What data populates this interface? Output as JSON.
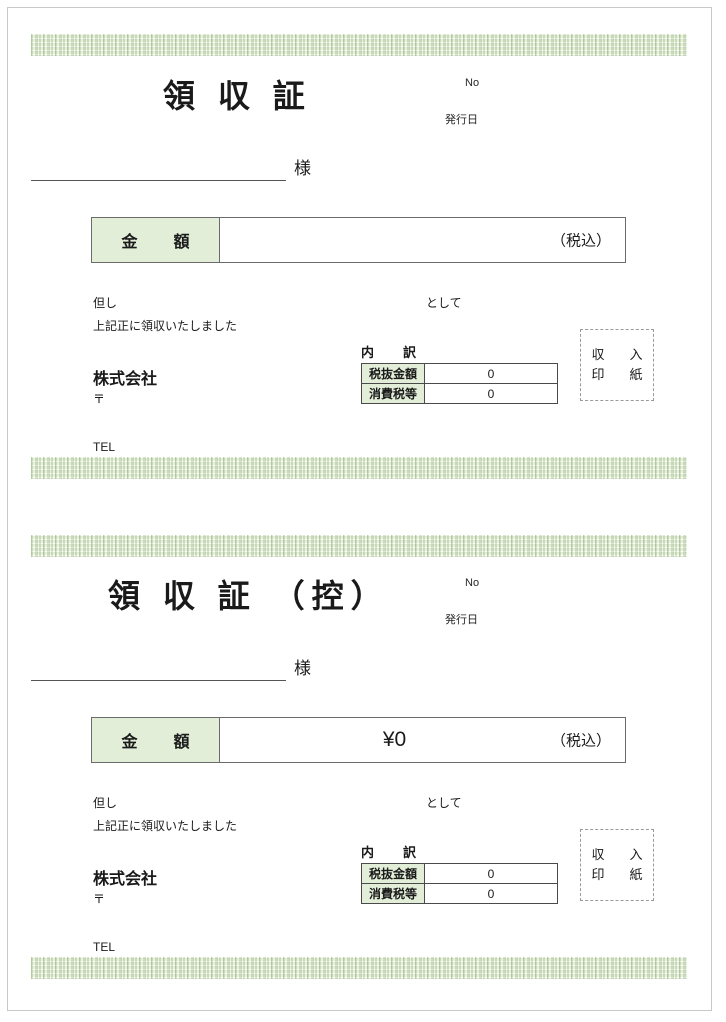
{
  "document": {
    "type": "japanese-receipt-template",
    "page_count": 1
  },
  "receipts": [
    {
      "id": "receipt-original",
      "title": "領 収 証",
      "no_label": "No",
      "issue_date_label": "発行日",
      "addressee_suffix": "様",
      "amount": {
        "label": "金　額",
        "value": "",
        "tax_note": "（税込）"
      },
      "notes": {
        "tadashi": "但し",
        "toshite": "として",
        "confirm": "上記正に領収いたしました"
      },
      "issuer": {
        "company": "株式会社",
        "postal": "〒",
        "tel": "TEL"
      },
      "breakdown": {
        "title": "内　訳",
        "rows": [
          {
            "label": "税抜金額",
            "value": "0"
          },
          {
            "label": "消費税等",
            "value": "0"
          }
        ]
      },
      "stamp": {
        "line1": "収　入",
        "line2": "印　紙"
      }
    },
    {
      "id": "receipt-copy",
      "title": "領 収 証 （控）",
      "no_label": "No",
      "issue_date_label": "発行日",
      "addressee_suffix": "様",
      "amount": {
        "label": "金　額",
        "value": "¥0",
        "tax_note": "（税込）"
      },
      "notes": {
        "tadashi": "但し",
        "toshite": "として",
        "confirm": "上記正に領収いたしました"
      },
      "issuer": {
        "company": "株式会社",
        "postal": "〒",
        "tel": "TEL"
      },
      "breakdown": {
        "title": "内　訳",
        "rows": [
          {
            "label": "税抜金額",
            "value": "0"
          },
          {
            "label": "消費税等",
            "value": "0"
          }
        ]
      },
      "stamp": {
        "line1": "収　入",
        "line2": "印　紙"
      }
    }
  ],
  "colors": {
    "accent_green": "#e2eed8",
    "band_green": "#d9e8cb",
    "border_gray": "#6b6b6b",
    "text": "#1a1a1a"
  }
}
